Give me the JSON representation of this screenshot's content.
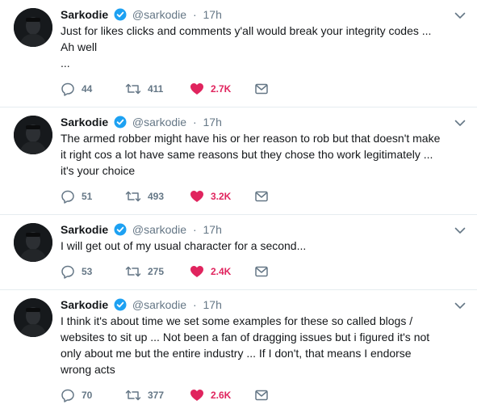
{
  "colors": {
    "text": "#14171a",
    "muted": "#657786",
    "verified": "#1da1f2",
    "like": "#e0245e",
    "divider": "#e6ecf0"
  },
  "tweets": [
    {
      "name": "Sarkodie",
      "handle": "@sarkodie",
      "separator": "·",
      "time": "17h",
      "text": "Just for likes clicks and comments y'all would break your integrity codes ... Ah well\n...",
      "replies": "44",
      "retweets": "411",
      "likes": "2.7K",
      "liked": true
    },
    {
      "name": "Sarkodie",
      "handle": "@sarkodie",
      "separator": "·",
      "time": "17h",
      "text": "The armed robber might have his or her reason to rob but that doesn't make it right cos a lot have same reasons but they chose tho work legitimately ... it's your choice",
      "replies": "51",
      "retweets": "493",
      "likes": "3.2K",
      "liked": true
    },
    {
      "name": "Sarkodie",
      "handle": "@sarkodie",
      "separator": "·",
      "time": "17h",
      "text": "I will get out of my usual character for a second...",
      "replies": "53",
      "retweets": "275",
      "likes": "2.4K",
      "liked": true
    },
    {
      "name": "Sarkodie",
      "handle": "@sarkodie",
      "separator": "·",
      "time": "17h",
      "text": "I think it's about time we set some examples for these so called blogs / websites to sit up ... Not been a fan of dragging issues but i figured it's not only about me but the entire industry ... If I don't, that means I endorse wrong acts",
      "replies": "70",
      "retweets": "377",
      "likes": "2.6K",
      "liked": true
    }
  ]
}
